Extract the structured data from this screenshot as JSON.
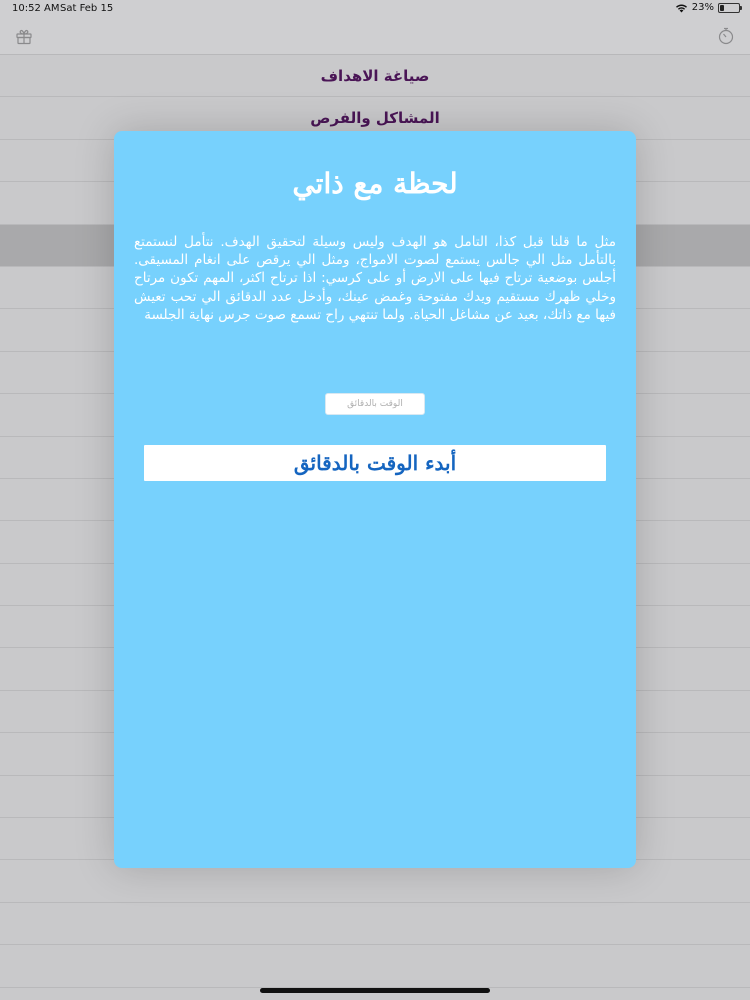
{
  "status_bar": {
    "time": "10:52 AM",
    "date": "Sat Feb 15",
    "battery": "23%",
    "battery_level": 0.23
  },
  "nav": {
    "left_icon": "gift-icon",
    "right_icon": "timer-icon"
  },
  "list": {
    "items": [
      "صياغة الاهداف",
      "المشاكل والفرص"
    ]
  },
  "modal": {
    "title": "لحظة مع ذاتي",
    "body": "مثل ما قلنا قبل كذا، التامل هو الهدف وليس وسيلة لتحقيق الهدف. نتأمل لنستمتع بالتأمل مثل الي جالس يستمع لصوت الامواج، ومثل الي يرقص على انغام المسيقى. أجلس بوضعية ترتاح فيها على الارض أو على كرسي: اذا ترتاح اكثر، المهم تكون مرتاح وخلي ظهرك مستقيم ويدك مفتوحة وغمض عينك، وأدخل عدد الدقائق الي تحب تعيش فيها مع ذاتك، بعيد عن مشاغل الحياة. ولما تنتهي راح تسمع صوت جرس نهاية الجلسة",
    "minutes_placeholder": "الوقت بالدقائق",
    "minutes_value": "",
    "start_label": "أبدء الوقت بالدقائق"
  },
  "colors": {
    "modal_bg": "#77d1fd",
    "title_purple": "#4a1556",
    "button_text": "#1565c0"
  }
}
